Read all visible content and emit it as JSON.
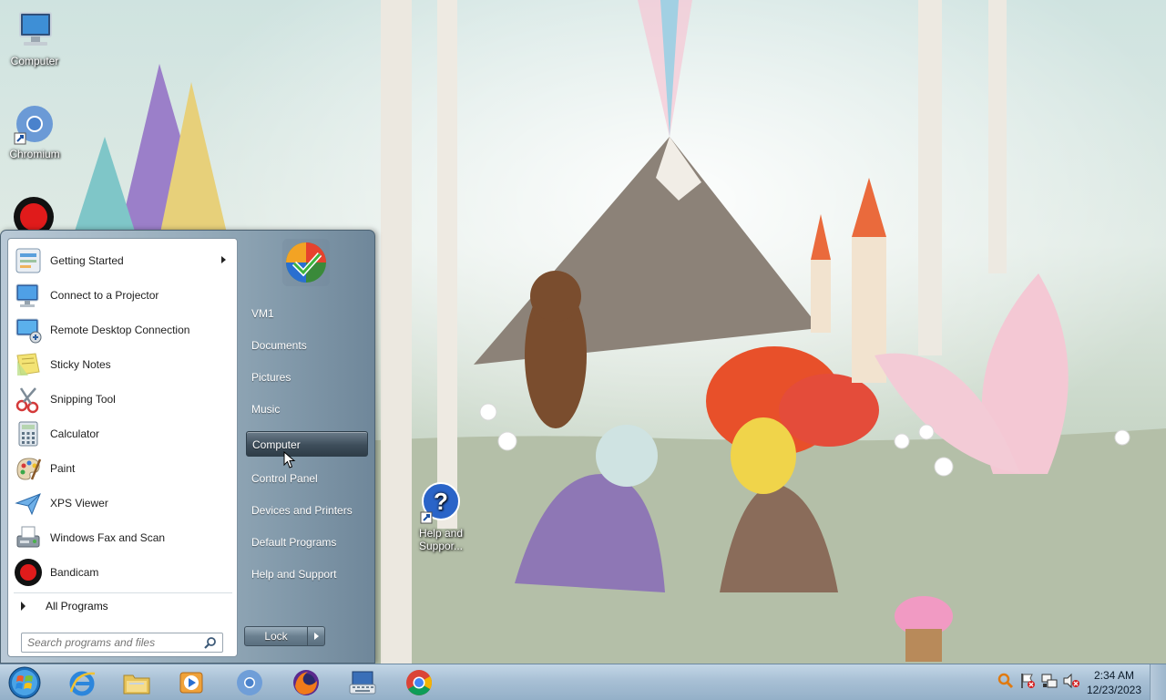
{
  "desktop": {
    "icons": [
      {
        "label": "Computer"
      },
      {
        "label": "Chromium"
      },
      {
        "label": "Help and Suppor..."
      }
    ]
  },
  "start_menu": {
    "programs": [
      {
        "label": "Getting Started",
        "icon": "getting-started-icon",
        "has_submenu": true
      },
      {
        "label": "Connect to a Projector",
        "icon": "projector-icon"
      },
      {
        "label": "Remote Desktop Connection",
        "icon": "remote-desktop-icon"
      },
      {
        "label": "Sticky Notes",
        "icon": "sticky-notes-icon"
      },
      {
        "label": "Snipping Tool",
        "icon": "scissors-icon"
      },
      {
        "label": "Calculator",
        "icon": "calculator-icon"
      },
      {
        "label": "Paint",
        "icon": "paint-palette-icon"
      },
      {
        "label": "XPS Viewer",
        "icon": "xps-viewer-icon"
      },
      {
        "label": "Windows Fax and Scan",
        "icon": "fax-icon"
      },
      {
        "label": "Bandicam",
        "icon": "bandicam-icon"
      }
    ],
    "all_programs": "All Programs",
    "search_placeholder": "Search programs and files",
    "right_items": [
      {
        "label": "VM1"
      },
      {
        "label": "Documents"
      },
      {
        "label": "Pictures"
      },
      {
        "label": "Music"
      },
      {
        "label": "Computer",
        "highlighted": true
      },
      {
        "label": "Control Panel"
      },
      {
        "label": "Devices and Printers"
      },
      {
        "label": "Default Programs"
      },
      {
        "label": "Help and Support"
      }
    ],
    "lock_label": "Lock"
  },
  "taskbar": {
    "pinned": [
      {
        "name": "internet-explorer-icon"
      },
      {
        "name": "file-explorer-icon"
      },
      {
        "name": "media-player-icon"
      },
      {
        "name": "chromium-icon"
      },
      {
        "name": "firefox-icon"
      },
      {
        "name": "on-screen-keyboard-icon"
      },
      {
        "name": "chrome-icon"
      }
    ],
    "tray_icons": [
      "bandicam-tray-icon",
      "action-center-flag-icon",
      "network-icon",
      "volume-muted-icon"
    ],
    "clock": {
      "time": "2:34 AM",
      "date": "12/23/2023"
    }
  },
  "colors": {
    "start_menu_right": "#7d93a5",
    "highlight": "#3e4e5b",
    "taskbar": "#a8c0d5"
  }
}
